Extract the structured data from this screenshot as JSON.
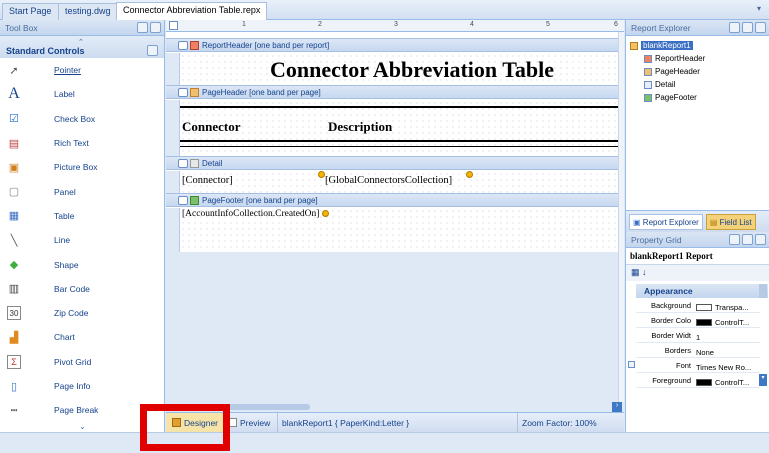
{
  "tabs": [
    {
      "label": "Start Page",
      "active": false
    },
    {
      "label": "testing.dwg",
      "active": false
    },
    {
      "label": "Connector Abbreviation Table.repx",
      "active": true
    }
  ],
  "toolbox": {
    "title": "Tool Box",
    "section": "Standard Controls",
    "items": [
      {
        "label": "Pointer",
        "icon": "pointer-icon",
        "glyph": "➚",
        "selected": true
      },
      {
        "label": "Label",
        "icon": "label-icon",
        "glyph": "A",
        "selected": false
      },
      {
        "label": "Check Box",
        "icon": "checkbox-icon",
        "glyph": "☑",
        "selected": false
      },
      {
        "label": "Rich Text",
        "icon": "rich-text-icon",
        "glyph": "▤",
        "selected": false
      },
      {
        "label": "Picture Box",
        "icon": "picture-box-icon",
        "glyph": "▣",
        "selected": false
      },
      {
        "label": "Panel",
        "icon": "panel-icon",
        "glyph": "▢",
        "selected": false
      },
      {
        "label": "Table",
        "icon": "table-icon",
        "glyph": "▦",
        "selected": false
      },
      {
        "label": "Line",
        "icon": "line-icon",
        "glyph": "╲",
        "selected": false
      },
      {
        "label": "Shape",
        "icon": "shape-icon",
        "glyph": "◆",
        "selected": false
      },
      {
        "label": "Bar Code",
        "icon": "barcode-icon",
        "glyph": "▥",
        "selected": false
      },
      {
        "label": "Zip Code",
        "icon": "zipcode-icon",
        "glyph": "30",
        "selected": false
      },
      {
        "label": "Chart",
        "icon": "chart-icon",
        "glyph": "▟",
        "selected": false
      },
      {
        "label": "Pivot Grid",
        "icon": "pivot-grid-icon",
        "glyph": "Σ",
        "selected": false
      },
      {
        "label": "Page Info",
        "icon": "page-info-icon",
        "glyph": "▯",
        "selected": false
      },
      {
        "label": "Page Break",
        "icon": "page-break-icon",
        "glyph": "┅",
        "selected": false
      }
    ]
  },
  "designer": {
    "ruler_marks": [
      "1",
      "2",
      "3",
      "4",
      "5",
      "6"
    ],
    "bands": {
      "report_header": "ReportHeader [one band per report]",
      "page_header": "PageHeader [one band per page]",
      "detail": "Detail",
      "page_footer": "PageFooter [one band per page]"
    },
    "report_title": "Connector Abbreviation Table",
    "col_connector": "Connector",
    "col_description": "Description",
    "field_connector": "[Connector]",
    "field_global": "[GlobalConnectorsCollection]",
    "field_created": "[AccountInfoCollection.CreatedOn]"
  },
  "statusbar": {
    "designer_tab": "Designer",
    "preview_tab": "Preview",
    "report_info": "blankReport1 { PaperKind:Letter }",
    "zoom": "Zoom Factor: 100%"
  },
  "report_explorer": {
    "title": "Report Explorer",
    "root": "blankReport1",
    "children": [
      "ReportHeader",
      "PageHeader",
      "Detail",
      "PageFooter"
    ],
    "tab_explorer": "Report Explorer",
    "tab_fieldlist": "Field List"
  },
  "property_grid": {
    "title": "Property Grid",
    "object": "blankReport1  Report",
    "toolbar_glyphs": "▦ ↓",
    "category": "Appearance",
    "rows": [
      {
        "name": "Background",
        "value": "Transpa...",
        "swatch": "#ffffff"
      },
      {
        "name": "Border Colo",
        "value": "ControlT...",
        "swatch": "#000000"
      },
      {
        "name": "Border Widt",
        "value": "1",
        "swatch": ""
      },
      {
        "name": "Borders",
        "value": "None",
        "swatch": ""
      },
      {
        "name": "Font",
        "value": "Times New Ro...",
        "swatch": ""
      },
      {
        "name": "Foreground",
        "value": "ControlT...",
        "swatch": "#000000"
      }
    ]
  },
  "colors": {
    "highlight": "#e00000",
    "selection": "#3a6fc4",
    "chrome": "#dfe8f5"
  }
}
